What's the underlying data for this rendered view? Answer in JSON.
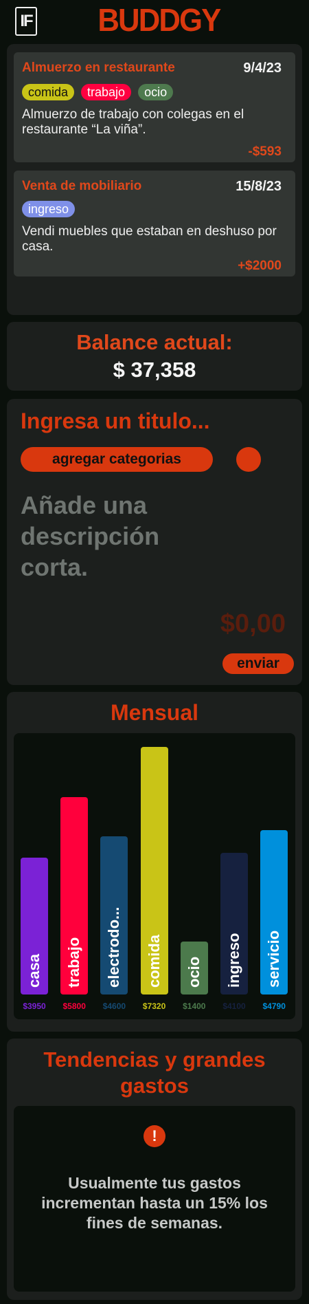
{
  "header": {
    "logo_text": "IF",
    "brand": "BUDDGY"
  },
  "transactions": [
    {
      "title": "Almuerzo en restaurante",
      "date": "9/4/23",
      "tags": [
        {
          "label": "comida",
          "color": "#c9c417"
        },
        {
          "label": "trabajo",
          "color": "#ff0040"
        },
        {
          "label": "ocio",
          "color": "#4e7a4e"
        }
      ],
      "description": "Almuerzo de trabajo con colegas en el restaurante “La viña”.",
      "amount": "-$593"
    },
    {
      "title": "Venta de mobiliario",
      "date": "15/8/23",
      "tags": [
        {
          "label": "ingreso",
          "color": "#7f90e8"
        }
      ],
      "description": "Vendi muebles que estaban en deshuso por casa.",
      "amount": "+$2000"
    }
  ],
  "balance": {
    "label": "Balance actual:",
    "value": "$ 37,358"
  },
  "form": {
    "title_placeholder": "Ingresa un titulo...",
    "categories_button": "agregar categorias",
    "description_placeholder": "Añade una descripción corta.",
    "amount_placeholder": "$0,00",
    "send_button": "enviar"
  },
  "monthly": {
    "title": "Mensual",
    "chart_data": {
      "type": "bar",
      "categories": [
        "casa",
        "trabajo",
        "electrodo...",
        "comida",
        "ocio",
        "ingreso",
        "servicio"
      ],
      "values": [
        3950,
        5800,
        4600,
        7320,
        1400,
        4100,
        4790
      ],
      "value_labels": [
        "$3950",
        "$5800",
        "$4600",
        "$7320",
        "$1400",
        "$4100",
        "$4790"
      ],
      "colors": [
        "#7b22d6",
        "#ff003c",
        "#154a72",
        "#c9c417",
        "#4c7a4c",
        "#16213f",
        "#0090dc"
      ],
      "value_label_colors": [
        "#7b22d6",
        "#ff003c",
        "#154a72",
        "#c9c417",
        "#4c7a4c",
        "#16213f",
        "#0090dc"
      ]
    }
  },
  "trends": {
    "title": "Tendencias y grandes gastos",
    "icon": "alert-icon",
    "message": "Usualmente tus gastos incrementan hasta un 15% los fines de semanas."
  }
}
